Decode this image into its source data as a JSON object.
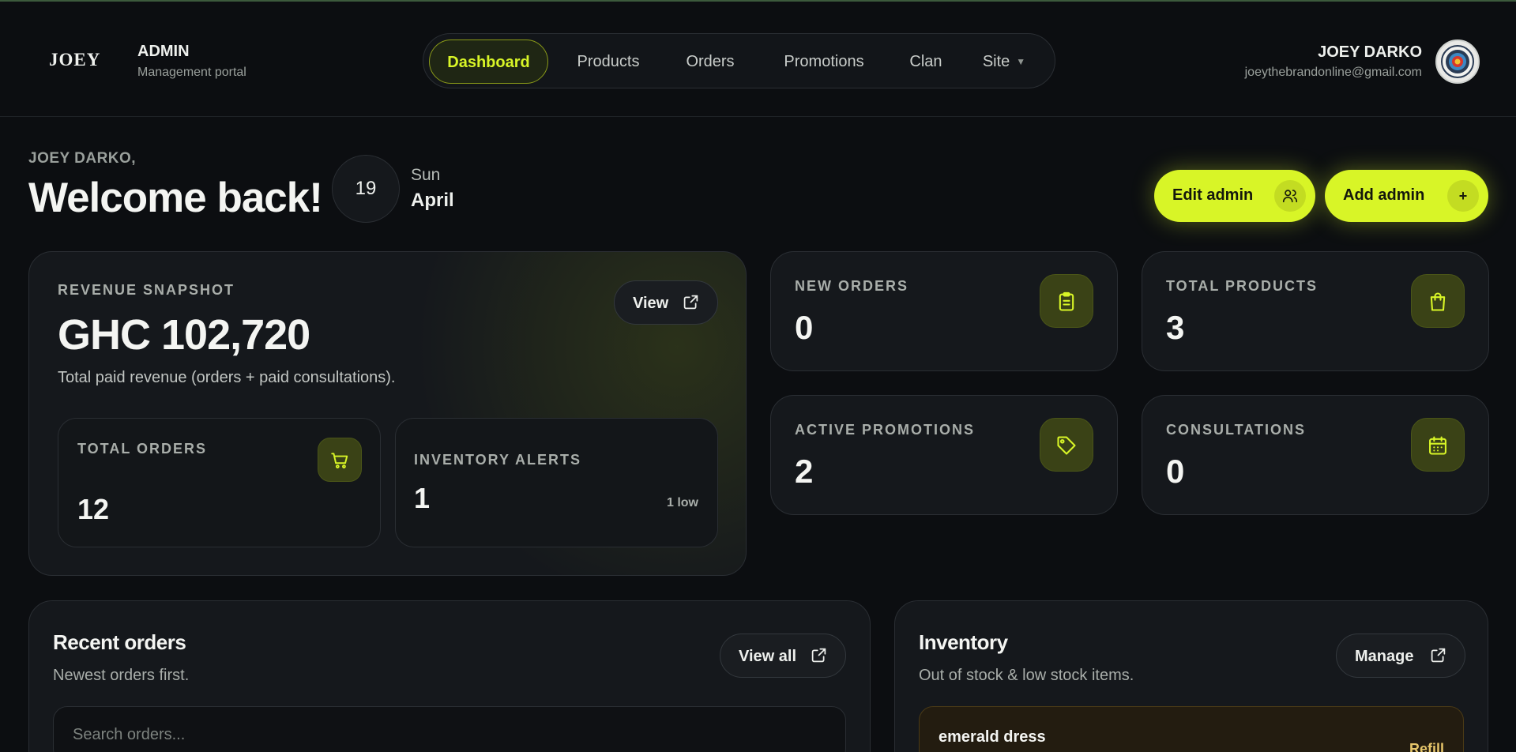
{
  "header": {
    "logo": "JOEY",
    "brand_title": "ADMIN",
    "brand_subtitle": "Management portal",
    "nav": [
      "Dashboard",
      "Products",
      "Orders",
      "Promotions",
      "Clan",
      "Site"
    ],
    "active_nav": "Dashboard",
    "user_name": "JOEY DARKO",
    "user_email": "joeythebrandonline@gmail.com"
  },
  "welcome": {
    "name": "JOEY DARKO,",
    "title": "Welcome back!",
    "date_number": "19",
    "date_day": "Sun",
    "date_month": "April",
    "edit_admin": "Edit admin",
    "add_admin": "Add admin",
    "add_symbol": "+"
  },
  "revenue": {
    "label": "REVENUE SNAPSHOT",
    "amount": "GHC 102,720",
    "description": "Total paid revenue (orders + paid consultations).",
    "view_label": "View",
    "total_orders_label": "TOTAL ORDERS",
    "total_orders": "12",
    "inventory_alerts_label": "INVENTORY ALERTS",
    "inventory_alerts": "1",
    "inventory_low": "1 low"
  },
  "stats": {
    "new_orders_label": "NEW ORDERS",
    "new_orders": "0",
    "total_products_label": "TOTAL PRODUCTS",
    "total_products": "3",
    "active_promotions_label": "ACTIVE PROMOTIONS",
    "active_promotions": "2",
    "consultations_label": "CONSULTATIONS",
    "consultations": "0"
  },
  "recent_orders": {
    "title": "Recent orders",
    "subtitle": "Newest orders first.",
    "view_all": "View all",
    "search_placeholder": "Search orders..."
  },
  "inventory": {
    "title": "Inventory",
    "subtitle": "Out of stock & low stock items.",
    "manage": "Manage",
    "item_name": "emerald dress",
    "item_action": "Refill"
  },
  "colors": {
    "accent": "#d8f527",
    "background": "#0c0e11",
    "card": "#15181c",
    "icon_box": "#3a4216",
    "warning": "#e6c56a"
  }
}
